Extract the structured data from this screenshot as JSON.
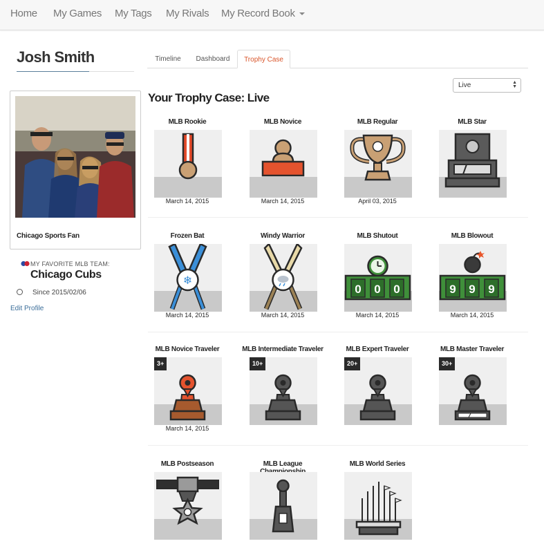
{
  "nav": {
    "items": [
      {
        "label": "Home"
      },
      {
        "label": "My Games"
      },
      {
        "label": "My Tags"
      },
      {
        "label": "My Rivals"
      },
      {
        "label": "My Record Book"
      }
    ]
  },
  "profile": {
    "name": "Josh Smith",
    "caption": "Chicago Sports Fan",
    "fav_label": "MY FAVORITE MLB TEAM:",
    "fav_team": "Chicago Cubs",
    "since": "Since 2015/02/06",
    "edit_link": "Edit Profile"
  },
  "tabs": [
    {
      "label": "Timeline"
    },
    {
      "label": "Dashboard"
    },
    {
      "label": "Trophy Case"
    }
  ],
  "filter": {
    "selected": "Live"
  },
  "page_title": "Your Trophy Case: Live",
  "trophies": [
    {
      "name": "MLB Rookie",
      "date": "March 14, 2015"
    },
    {
      "name": "MLB Novice",
      "date": "March 14, 2015"
    },
    {
      "name": "MLB Regular",
      "date": "April 03, 2015"
    },
    {
      "name": "MLB Star",
      "date": ""
    },
    {
      "name": "Frozen Bat",
      "date": "March 14, 2015"
    },
    {
      "name": "Windy Warrior",
      "date": "March 14, 2015"
    },
    {
      "name": "MLB Shutout",
      "date": "March 14, 2015",
      "score": [
        "0",
        "0",
        "0"
      ]
    },
    {
      "name": "MLB Blowout",
      "date": "March 14, 2015",
      "score": [
        "9",
        "9",
        "9"
      ]
    },
    {
      "name": "MLB Novice Traveler",
      "date": "March 14, 2015",
      "badge": "3+"
    },
    {
      "name": "MLB Intermediate Traveler",
      "date": "",
      "badge": "10+"
    },
    {
      "name": "MLB Expert Traveler",
      "date": "",
      "badge": "20+"
    },
    {
      "name": "MLB Master Traveler",
      "date": "",
      "badge": "30+"
    },
    {
      "name": "MLB Postseason",
      "date": ""
    },
    {
      "name": "MLB League Championship",
      "date": ""
    },
    {
      "name": "MLB World Series",
      "date": ""
    }
  ],
  "colors": {
    "active_tab": "#d9552a",
    "link": "#3a6d99",
    "scoreboard_green": "#3f8f3a"
  }
}
